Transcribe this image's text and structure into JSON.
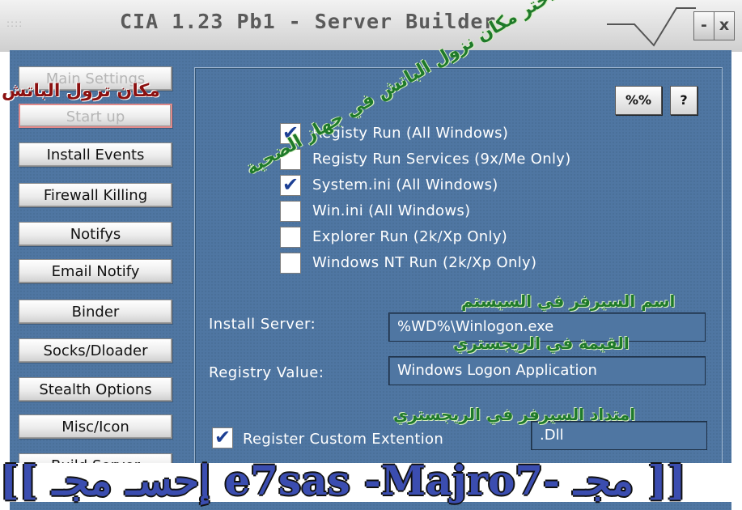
{
  "window": {
    "title": "CIA 1.23 Pb1 - Server Builder",
    "grip": "::::",
    "minimize_label": "-",
    "close_label": "x"
  },
  "sidebar": {
    "items": [
      {
        "label": "Main Settings"
      },
      {
        "label": "Start up"
      },
      {
        "label": "Install Events"
      },
      {
        "label": "Firewall Killing"
      },
      {
        "label": "Notifys"
      },
      {
        "label": "Email Notify"
      },
      {
        "label": "Binder"
      },
      {
        "label": "Socks/Dloader"
      },
      {
        "label": "Stealth Options"
      },
      {
        "label": "Misc/Icon"
      },
      {
        "label": "Build Server"
      }
    ]
  },
  "toolbar": {
    "percent_label": "%%",
    "help_label": "?"
  },
  "startup_options": [
    {
      "label": "Registy Run (All Windows)",
      "checked": true
    },
    {
      "label": "Registy Run Services (9x/Me Only)",
      "checked": false
    },
    {
      "label": "System.ini (All Windows)",
      "checked": true
    },
    {
      "label": "Win.ini (All Windows)",
      "checked": false
    },
    {
      "label": "Explorer Run (2k/Xp Only)",
      "checked": false
    },
    {
      "label": "Windows NT Run  (2k/Xp Only)",
      "checked": false
    }
  ],
  "check_mark": "✔",
  "install_server": {
    "label": "Install Server:",
    "value": "%WD%\\Winlogon.exe"
  },
  "registry_value": {
    "label": "Registry Value:",
    "value": "Windows Logon Application"
  },
  "custom_extension": {
    "label": "Register Custom Extention",
    "checked": true,
    "value": ".Dll"
  },
  "annotations": {
    "startup_location": "مكان ترول الباتش",
    "choose_startup": "اختر مكان نزول الباتش في جهاز الضحية",
    "server_name": "اسم السيرفر في السيستم",
    "registry_value": "القيمة في الريجستري",
    "extension": "امتداد السيرفر في الريجستري"
  },
  "banner_text": "[[ إحسـ مجـ e7sas -Majro7- مجـ ]]",
  "colors": {
    "panel": "#4f76a2",
    "check": "#1c3f94",
    "annotation_red": "#8b1010",
    "annotation_green": "#1f7a2a",
    "banner": "#3b4db0"
  }
}
